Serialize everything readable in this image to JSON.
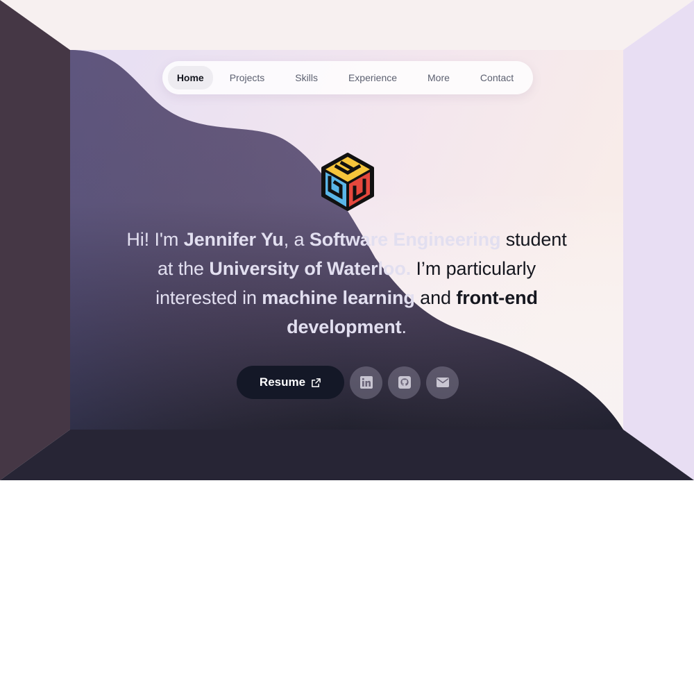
{
  "nav": {
    "items": [
      {
        "label": "Home",
        "active": true
      },
      {
        "label": "Projects",
        "active": false
      },
      {
        "label": "Skills",
        "active": false
      },
      {
        "label": "Experience",
        "active": false
      },
      {
        "label": "More",
        "active": false
      },
      {
        "label": "Contact",
        "active": false
      }
    ]
  },
  "logo": {
    "icon": "cube-logo-icon",
    "colors": [
      "#f6c53b",
      "#5ab6e8",
      "#e6483d"
    ]
  },
  "bio": {
    "line1": {
      "p1": "Hi! I'm ",
      "p2": "Jennifer Yu",
      "p3": ", a ",
      "p4": "Software Engineering",
      "p5": " student"
    },
    "line2": {
      "p1": "at the ",
      "p2": "University of Waterloo.",
      "p3": " I’m particularly"
    },
    "line3": {
      "p1": "interested in ",
      "p2": "machine learning",
      "p3": " and ",
      "p4": "front-end"
    },
    "line4": {
      "p1": "development",
      "p2": "."
    }
  },
  "actions": {
    "resume_label": "Resume",
    "resume_icon": "external-link-icon",
    "social": [
      "linkedin-icon",
      "github-icon",
      "email-icon"
    ]
  },
  "colors": {
    "ceiling": "#f7f0f0",
    "left_wall": "#453745",
    "right_wall": "#e8def3",
    "floor": "#272535",
    "button": "#141827"
  }
}
